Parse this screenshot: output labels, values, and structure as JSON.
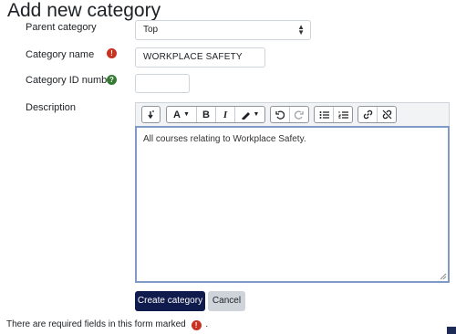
{
  "page": {
    "title": "Add new category"
  },
  "form": {
    "parent": {
      "label": "Parent category",
      "value": "Top"
    },
    "name": {
      "label": "Category name",
      "value": "WORKPLACE SAFETY",
      "required_icon": "exclamation-icon"
    },
    "idnumber": {
      "label": "Category ID number",
      "value": "",
      "help_icon": "question-icon"
    },
    "description": {
      "label": "Description",
      "text": "All courses relating to Workplace Safety."
    }
  },
  "toolbar": {
    "buttons": [
      {
        "name": "collapse-toolbar-icon"
      },
      {
        "name": "font-color-icon",
        "label": "A"
      },
      {
        "name": "bold-icon",
        "label": "B"
      },
      {
        "name": "italic-icon",
        "label": "I"
      },
      {
        "name": "highlight-icon"
      },
      {
        "name": "undo-icon"
      },
      {
        "name": "redo-icon"
      },
      {
        "name": "bullet-list-icon"
      },
      {
        "name": "numbered-list-icon"
      },
      {
        "name": "link-icon"
      },
      {
        "name": "unlink-icon"
      }
    ]
  },
  "actions": {
    "create_label": "Create category",
    "cancel_label": "Cancel"
  },
  "footer": {
    "required_note": "There are required fields in this form marked",
    "required_note_end": "."
  },
  "colors": {
    "primary": "#0f1b4c",
    "required": "#ca3120",
    "help": "#357a32",
    "editor_focus": "#7f9ac6"
  }
}
